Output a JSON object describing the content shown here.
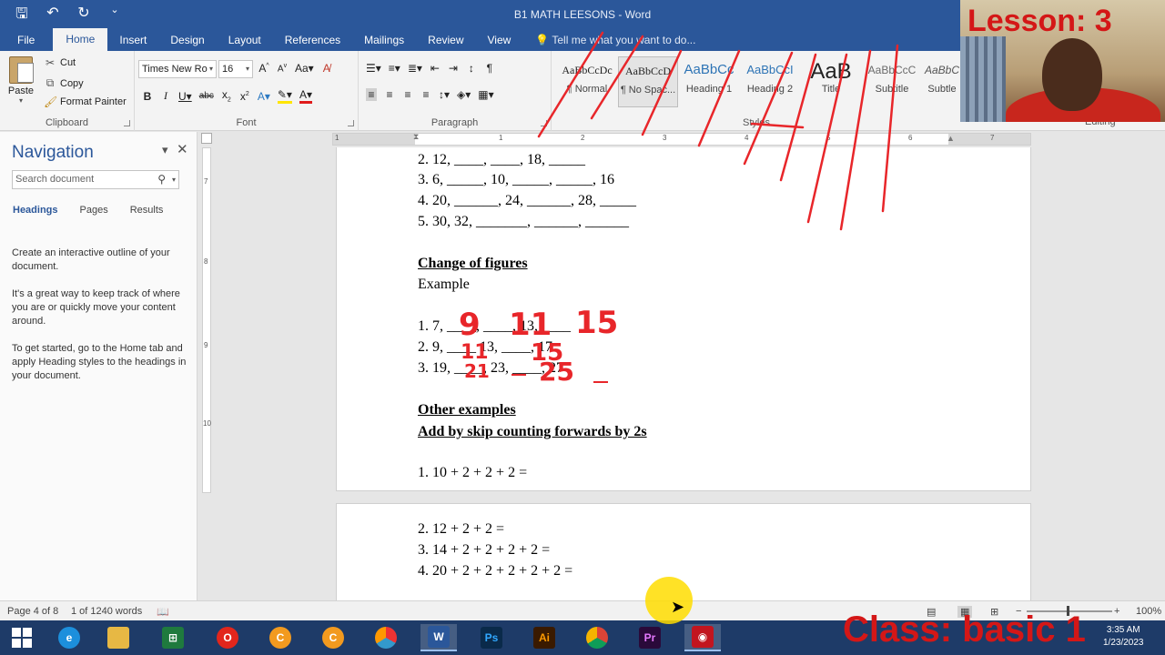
{
  "window": {
    "title": "B1 MATH LEESONS - Word"
  },
  "qat": {
    "save": "🖫",
    "undo": "↶",
    "redo": "↻",
    "more": "⌄"
  },
  "tabs": [
    "File",
    "Home",
    "Insert",
    "Design",
    "Layout",
    "References",
    "Mailings",
    "Review",
    "View"
  ],
  "tellme": "Tell me what you want to do...",
  "ribbon": {
    "clipboard": {
      "label": "Clipboard",
      "paste": "Paste",
      "cut": "Cut",
      "copy": "Copy",
      "format_painter": "Format Painter"
    },
    "font": {
      "label": "Font",
      "name": "Times New Ro",
      "size": "16"
    },
    "paragraph": {
      "label": "Paragraph"
    },
    "styles": {
      "label": "Styles",
      "items": [
        {
          "preview": "AaBbCcDc",
          "name": "¶ Normal"
        },
        {
          "preview": "AaBbCcD",
          "name": "¶ No Spac..."
        },
        {
          "preview": "AaBbCc",
          "name": "Heading 1"
        },
        {
          "preview": "AaBbCcI",
          "name": "Heading 2"
        },
        {
          "preview": "AaB",
          "name": "Title"
        },
        {
          "preview": "AaBbCcC",
          "name": "Subtitle"
        },
        {
          "preview": "AaBbC",
          "name": "Subtle"
        }
      ]
    },
    "editing": {
      "label": "Editing"
    }
  },
  "overlay": {
    "lesson": "Lesson: 3",
    "class": "Class: basic 1"
  },
  "ruler": {
    "numbers": [
      "1",
      "1",
      "2",
      "3",
      "4",
      "5",
      "6",
      "7"
    ],
    "vnumbers": [
      "7",
      "8",
      "9",
      "10"
    ]
  },
  "nav": {
    "title": "Navigation",
    "search_placeholder": "Search document",
    "tabs": [
      "Headings",
      "Pages",
      "Results"
    ],
    "paragraphs": [
      "Create an interactive outline of your document.",
      "It's a great way to keep track of where you are or quickly move your content around.",
      "To get started, go to the Home tab and apply Heading styles to the headings in your document."
    ]
  },
  "doc": {
    "page1": [
      "2. 12, ____, ____, 18, _____",
      "3. 6, _____, 10, _____, _____, 16",
      "4. 20, ______, 24, ______, 28, _____",
      "5. 30, 32, _______, ______, ______",
      "Change of figures",
      "Example",
      "1. 7, ____, ____, 13, ____",
      "2. 9, ____ 13, ____, 17",
      "3. 19, ____, 23, ____, 27",
      "Other examples",
      "Add by skip counting forwards by 2s",
      "1. 10 + 2 + 2 + 2 ="
    ],
    "page2": [
      "2. 12 + 2 + 2 =",
      "3. 14 + 2 + 2 + 2 + 2 =",
      "4. 20 + 2 + 2 + 2 + 2 + 2 ="
    ],
    "handwritten": [
      "9",
      "11",
      "15",
      "11",
      "15",
      "21",
      "25"
    ]
  },
  "status": {
    "page": "Page 4 of 8",
    "words": "1 of 1240 words",
    "zoom": "100%"
  },
  "taskbar": {
    "items": [
      "Windows",
      "Internet Explorer",
      "File Explorer",
      "Excel",
      "Opera",
      "CCleaner",
      "CCleaner",
      "Browser",
      "Word",
      "Photoshop",
      "Illustrator",
      "Chrome",
      "Premiere",
      "Recorder"
    ],
    "labels": {
      "word": "W",
      "ps": "Ps",
      "ai": "Ai",
      "pr": "Pr"
    },
    "time": "3:35 AM",
    "date": "1/23/2023"
  },
  "colors": {
    "ink": "#e8262a",
    "accent": "#2b579a",
    "overlay_text": "#d41717"
  }
}
